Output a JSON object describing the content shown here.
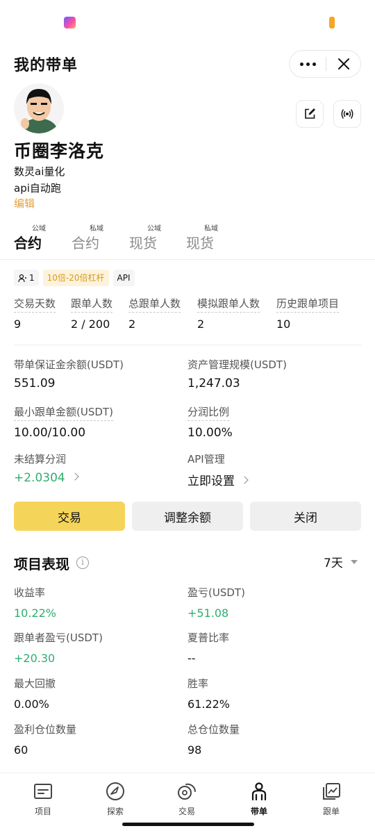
{
  "header": {
    "title": "我的带单"
  },
  "profile": {
    "nickname": "币圈李洛克",
    "bio_line1": "数灵ai量化",
    "bio_line2": "api自动跑",
    "edit_label": "编辑"
  },
  "tabs": [
    {
      "label": "合约",
      "sup": "公域",
      "active": true
    },
    {
      "label": "合约",
      "sup": "私域",
      "active": false
    },
    {
      "label": "现货",
      "sup": "公域",
      "active": false
    },
    {
      "label": "现货",
      "sup": "私域",
      "active": false
    }
  ],
  "tags": {
    "followers": "1",
    "leverage": "10倍-20倍杠杆",
    "api": "API"
  },
  "stats": [
    {
      "label": "交易天数",
      "value": "9"
    },
    {
      "label": "跟单人数",
      "value": "2 / 200"
    },
    {
      "label": "总跟单人数",
      "value": "2"
    },
    {
      "label": "模拟跟单人数",
      "value": "2"
    },
    {
      "label": "历史跟单项目",
      "value": "10"
    }
  ],
  "info": {
    "margin_balance_label": "带单保证金余额(USDT)",
    "margin_balance_value": "551.09",
    "aum_label": "资产管理规模(USDT)",
    "aum_value": "1,247.03",
    "min_copy_label": "最小跟单金额(USDT)",
    "min_copy_value": "10.00/10.00",
    "profit_share_label": "分润比例",
    "profit_share_value": "10.00%",
    "unsettled_label": "未结算分润",
    "unsettled_value": "+2.0304",
    "api_label": "API管理",
    "api_value": "立即设置"
  },
  "buttons": {
    "trade": "交易",
    "adjust": "调整余额",
    "close": "关闭"
  },
  "performance": {
    "title": "项目表现",
    "info_icon_glyph": "i",
    "period": "7天",
    "items": [
      {
        "label": "收益率",
        "value": "10.22%"
      },
      {
        "label": "盈亏(USDT)",
        "value": "+51.08"
      },
      {
        "label": "跟单者盈亏(USDT)",
        "value": "+20.30"
      },
      {
        "label": "夏普比率",
        "value": "--"
      },
      {
        "label": "最大回撤",
        "value": "0.00%"
      },
      {
        "label": "胜率",
        "value": "61.22%"
      },
      {
        "label": "盈利仓位数量",
        "value": "60"
      },
      {
        "label": "总仓位数量",
        "value": "98"
      }
    ]
  },
  "nav": [
    {
      "label": "项目",
      "icon": "project-icon"
    },
    {
      "label": "探索",
      "icon": "compass-icon"
    },
    {
      "label": "交易",
      "icon": "trade-icon"
    },
    {
      "label": "带单",
      "icon": "lead-icon",
      "active": true
    },
    {
      "label": "跟单",
      "icon": "copy-icon"
    }
  ],
  "colors": {
    "accent": "#f5d45a",
    "positive": "#2eae6e",
    "link": "#e6a13a"
  }
}
